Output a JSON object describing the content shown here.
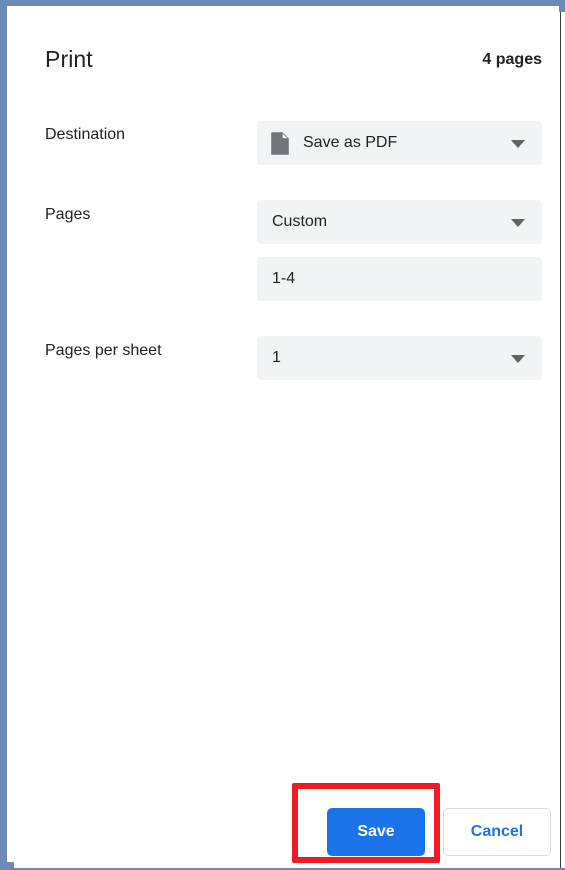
{
  "window": {
    "border_color": "#6b8ab8"
  },
  "dialog": {
    "title": "Print",
    "page_count": "4 pages",
    "settings": [
      {
        "label": "Destination",
        "type": "select",
        "value": "Save as PDF",
        "icon": "document-icon",
        "has_caret": true
      },
      {
        "label": "Pages",
        "type": "select",
        "value": "Custom",
        "icon": null,
        "has_caret": true
      },
      {
        "label": "",
        "type": "text",
        "value": "1-4",
        "icon": null,
        "has_caret": false
      },
      {
        "label": "Pages per sheet",
        "type": "select",
        "value": "1",
        "icon": null,
        "has_caret": true
      }
    ],
    "footer": {
      "save_label": "Save",
      "cancel_label": "Cancel",
      "save_color": "#1a73e8",
      "cancel_text_color": "#1a73e8"
    }
  },
  "annotation": {
    "type": "highlight-rectangle",
    "color": "#ee1c25",
    "target": "Save"
  }
}
